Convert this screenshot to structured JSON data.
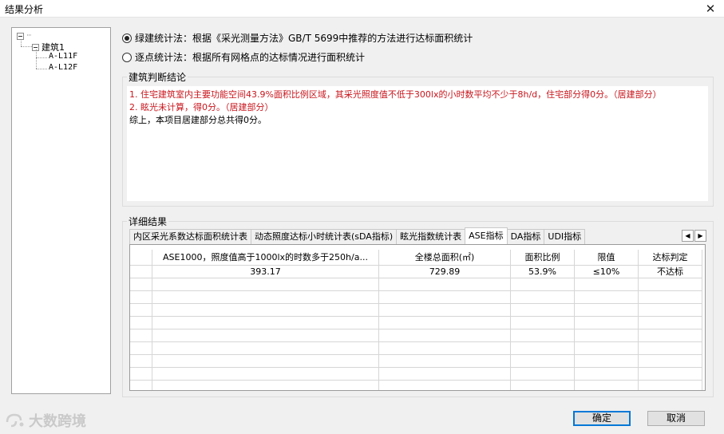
{
  "window": {
    "title": "结果分析",
    "close_glyph": "✕"
  },
  "tree": {
    "root_dots": "···",
    "building": "建筑1",
    "floors": [
      "A-L11F",
      "A-L12F"
    ]
  },
  "methods": [
    {
      "label": "绿建统计法：根据《采光测量方法》GB/T 5699中推荐的方法进行达标面积统计",
      "checked": true
    },
    {
      "label": "逐点统计法：根据所有网格点的达标情况进行面积统计",
      "checked": false
    }
  ],
  "conclusion": {
    "group_label": "建筑判断结论",
    "lines_red": [
      "1. 住宅建筑室内主要功能空间43.9%面积比例区域，其采光照度值不低于300lx的小时数平均不少于8h/d，住宅部分得0分。（居建部分）",
      "2. 眩光未计算，得0分。（居建部分）"
    ],
    "line_black": "综上，本项目居建部分总共得0分。"
  },
  "details": {
    "group_label": "详细结果",
    "tabs": [
      "内区采光系数达标面积统计表",
      "动态照度达标小时统计表(sDA指标)",
      "眩光指数统计表",
      "ASE指标",
      "DA指标",
      "UDI指标"
    ],
    "active_tab": 3,
    "scroll_left": "◀",
    "scroll_right": "▶",
    "table": {
      "columns": [
        "ASE1000，照度值高于1000lx的时数多于250h/a...",
        "全楼总面积(㎡)",
        "面积比例",
        "限值",
        "达标判定"
      ],
      "rows": [
        [
          "393.17",
          "729.89",
          "53.9%",
          "≤10%",
          "不达标"
        ]
      ]
    }
  },
  "buttons": {
    "ok": "确定",
    "cancel": "取消"
  },
  "watermark": "大数跨境"
}
